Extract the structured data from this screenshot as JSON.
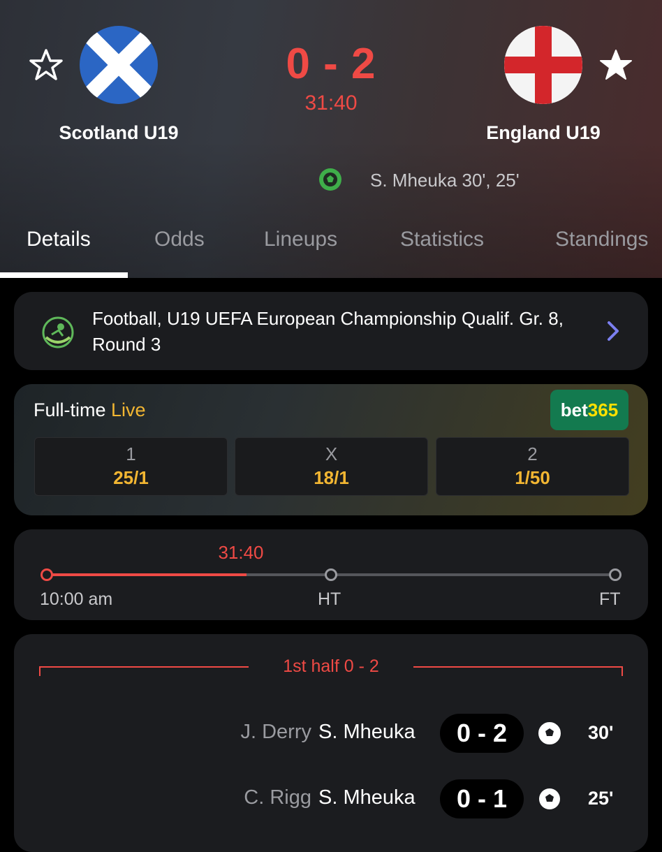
{
  "match": {
    "home": {
      "name": "Scotland U19",
      "favorite": false,
      "flag": "scotland-flag"
    },
    "away": {
      "name": "England U19",
      "favorite": true,
      "flag": "england-flag"
    },
    "score": "0 - 2",
    "clock": "31:40",
    "scorers_summary": "S. Mheuka 30', 25'"
  },
  "tabs": [
    "Details",
    "Odds",
    "Lineups",
    "Statistics",
    "Standings"
  ],
  "active_tab": "Details",
  "competition": {
    "text": "Football, U19 UEFA European Championship Qualif. Gr. 8, Round 3",
    "icon": "football-competition-icon"
  },
  "odds": {
    "title": "Full-time",
    "live_label": "Live",
    "bookmaker": {
      "part1": "bet",
      "part2": "365"
    },
    "options": [
      {
        "label": "1",
        "value": "25/1"
      },
      {
        "label": "X",
        "value": "18/1"
      },
      {
        "label": "2",
        "value": "1/50"
      }
    ]
  },
  "timeline": {
    "clock": "31:40",
    "start_label": "10:00 am",
    "ht_label": "HT",
    "ft_label": "FT",
    "progress_fraction": 0.352
  },
  "events": {
    "half_title": "1st half 0 - 2",
    "rows": [
      {
        "assist": "J. Derry",
        "scorer": "S. Mheuka",
        "score": "0 - 2",
        "minute": "30'"
      },
      {
        "assist": "C. Rigg",
        "scorer": "S. Mheuka",
        "score": "0 - 1",
        "minute": "25'"
      }
    ]
  },
  "colors": {
    "accent_red": "#ef4a45",
    "odds_gold": "#f2b632",
    "bet365_green": "#137a4f",
    "bet365_yellow": "#ffe000"
  }
}
